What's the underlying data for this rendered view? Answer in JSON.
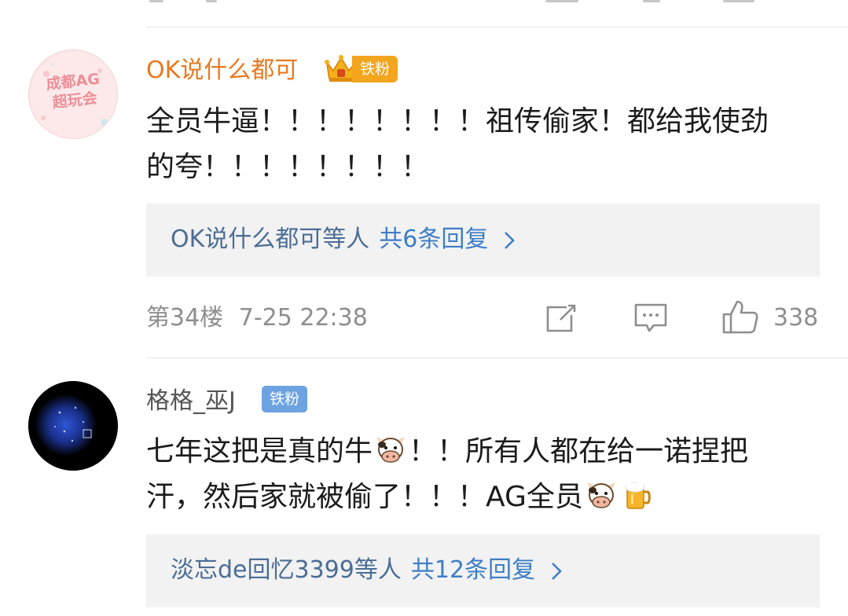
{
  "colors": {
    "vip_name": "#e9791f",
    "normal_name": "#555555",
    "fan_badge_gold": "#f2a51d",
    "fan_badge_blue": "#6ea3e2",
    "reply_link": "#3d7ec6"
  },
  "comments": [
    {
      "username": "OK说什么都可",
      "badge": "铁粉",
      "avatar_text_line1": "成都AG",
      "avatar_text_line2": "超玩会",
      "content_line1": "全员牛逼！！！！！！！！祖传偷家！都给我使劲",
      "content_line2": "的夸！！！！！！！！",
      "reply_who": "OK说什么都可等人",
      "reply_count": "共6条回复",
      "floor": "第34楼",
      "time": "7-25 22:38",
      "likes": "338"
    },
    {
      "username": "格格_巫J",
      "badge": "铁粉",
      "content_line1_a": "七年这把是真的牛",
      "content_line1_b": "！！所有人都在给一诺捏把",
      "content_line2_a": "汗，然后家就被偷了！！！AG全员",
      "reply_who": "淡忘de回忆3399等人",
      "reply_count": "共12条回复"
    }
  ]
}
